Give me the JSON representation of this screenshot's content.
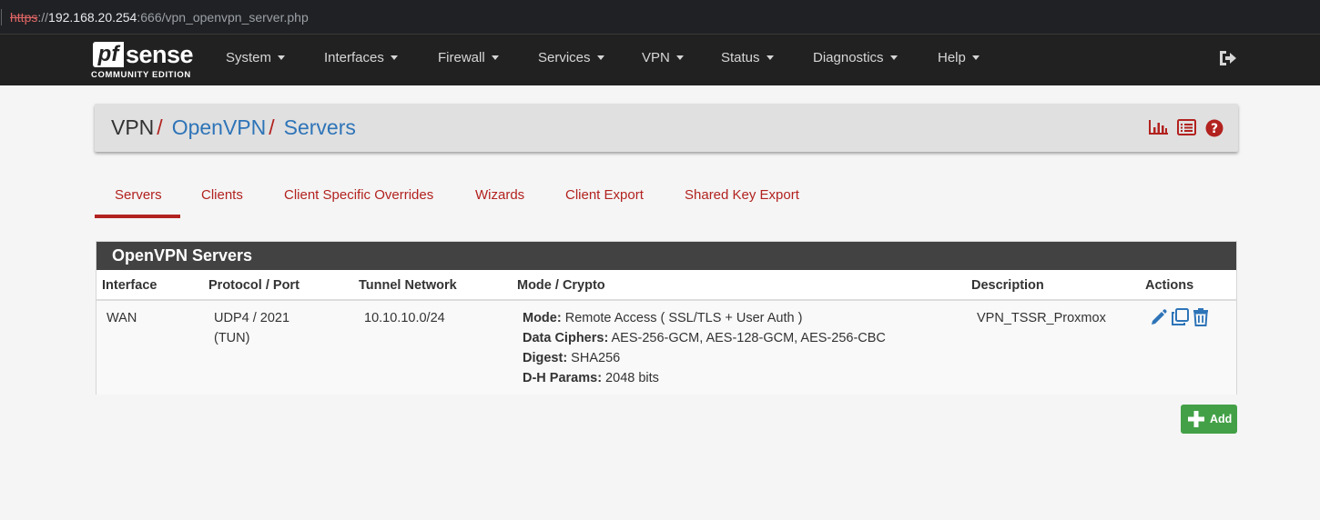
{
  "browser": {
    "url_scheme": "https",
    "url_sep": "://",
    "url_host": "192.168.20.254",
    "url_rest": ":666/vpn_openvpn_server.php"
  },
  "brand": {
    "pf": "pf",
    "sense": "sense",
    "edition": "COMMUNITY EDITION"
  },
  "nav": {
    "items": [
      {
        "label": "System"
      },
      {
        "label": "Interfaces"
      },
      {
        "label": "Firewall"
      },
      {
        "label": "Services"
      },
      {
        "label": "VPN"
      },
      {
        "label": "Status"
      },
      {
        "label": "Diagnostics"
      },
      {
        "label": "Help"
      }
    ],
    "logout_icon": "sign-out-icon"
  },
  "breadcrumb": {
    "root": "VPN",
    "sep": "/",
    "level1": "OpenVPN",
    "level2": "Servers",
    "icons": [
      "bar-chart-icon",
      "list-icon",
      "question-circle-icon"
    ]
  },
  "tabs": [
    {
      "label": "Servers",
      "active": true
    },
    {
      "label": "Clients"
    },
    {
      "label": "Client Specific Overrides"
    },
    {
      "label": "Wizards"
    },
    {
      "label": "Client Export"
    },
    {
      "label": "Shared Key Export"
    }
  ],
  "panel": {
    "title": "OpenVPN Servers",
    "columns": [
      "Interface",
      "Protocol / Port",
      "Tunnel Network",
      "Mode / Crypto",
      "Description",
      "Actions"
    ],
    "rows": [
      {
        "interface": "WAN",
        "protocol_port": "UDP4 / 2021",
        "protocol_dev": "(TUN)",
        "tunnel_network": "10.10.10.0/24",
        "mode_label": "Mode:",
        "mode_value": " Remote Access ( SSL/TLS + User Auth )",
        "ciphers_label": "Data Ciphers:",
        "ciphers_value": " AES-256-GCM, AES-128-GCM, AES-256-CBC",
        "digest_label": "Digest:",
        "digest_value": " SHA256",
        "dh_label": "D-H Params:",
        "dh_value": " 2048 bits",
        "description": "VPN_TSSR_Proxmox",
        "actions": [
          "pencil-icon",
          "clone-icon",
          "trash-icon"
        ]
      }
    ]
  },
  "add_button": {
    "label": "Add",
    "icon": "plus-icon"
  },
  "colors": {
    "navbar": "#212121",
    "accent_red": "#b2221f",
    "link_blue": "#2e74b8",
    "success_green": "#43a047",
    "panel_header": "#424242"
  }
}
